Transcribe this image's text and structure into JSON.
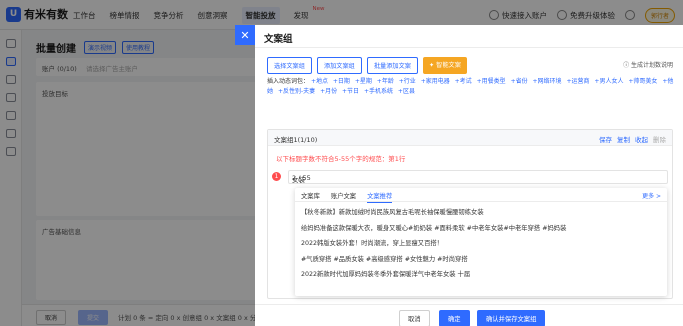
{
  "app": {
    "logo_mark": "U",
    "logo_text": "有米有数"
  },
  "nav": {
    "items": [
      "工作台",
      "榜单情报",
      "竞争分析",
      "创意洞察",
      "智能投放",
      "发现"
    ],
    "new_badge": "New",
    "active_index": 4
  },
  "topbar_right": {
    "quick_connect": "快速接入账户",
    "free_trial": "免费升级体验",
    "user": "郭行者"
  },
  "background": {
    "title": "批量创建",
    "tag_video": "演示视频",
    "tag_guide": "使用教程",
    "account_label": "账户 (0/10)",
    "account_placeholder": "请选择广告主账户",
    "target_label": "投放目标",
    "basic_label": "广告基础信息",
    "cancel": "取消",
    "submit": "提交",
    "summary": "计划 0 条 = 定向 0 x 创意组 0 x 文案组 0 x 分类"
  },
  "drawer": {
    "title": "文案组",
    "close_icon": "close-icon",
    "actions": {
      "select": "选择文案组",
      "add": "添加文案组",
      "batch_add": "批量添加文案",
      "smart": "智能文案"
    },
    "rule_link": "生成计划数说明",
    "vars_label": "插入动态词包：",
    "vars": [
      "+地点",
      "+日期",
      "+星期",
      "+年龄",
      "+行业",
      "+家用电器",
      "+考试",
      "+用餐类型",
      "+省份",
      "+网络环境",
      "+运营商",
      "+男人女人",
      "+帅哥美女",
      "+他她",
      "+反性别-夫妻",
      "+月份",
      "+节日",
      "+手机系统",
      "+区县"
    ],
    "group": {
      "title": "文案组1(1/10)",
      "actions": {
        "save": "保存",
        "copy": "复制",
        "collapse": "收起",
        "delete": "删除"
      },
      "error": "以下标题字数不符合5-55个字的规范：第1行",
      "row_number": "1",
      "input_value": "女装",
      "counter": "2 / 55"
    },
    "suggest": {
      "tabs": [
        "文案库",
        "账户文案",
        "文案推荐"
      ],
      "active_tab": 2,
      "more": "更多 >",
      "items": [
        "【秋冬新款】新款加绒时尚民族风复古毛呢长袖保暖慢腰韧练女装",
        "给妈妈准备这款保暖大衣，暖身又暖心#奶奶装 #面料柔软 #中老年女装#中老年穿搭 #妈妈装",
        "2022韩版女装外套！时尚潮流，穿上显瘦又百搭！",
        "#气质穿搭 #品质女装 #高级感穿搭 #女性魅力 #时尚穿搭",
        "2022新款时代加厚妈妈装冬季外套保暖洋气中老年女装 十届"
      ]
    },
    "footer": {
      "cancel": "取消",
      "confirm": "确定",
      "confirm_save": "确认并保存文案组"
    }
  }
}
